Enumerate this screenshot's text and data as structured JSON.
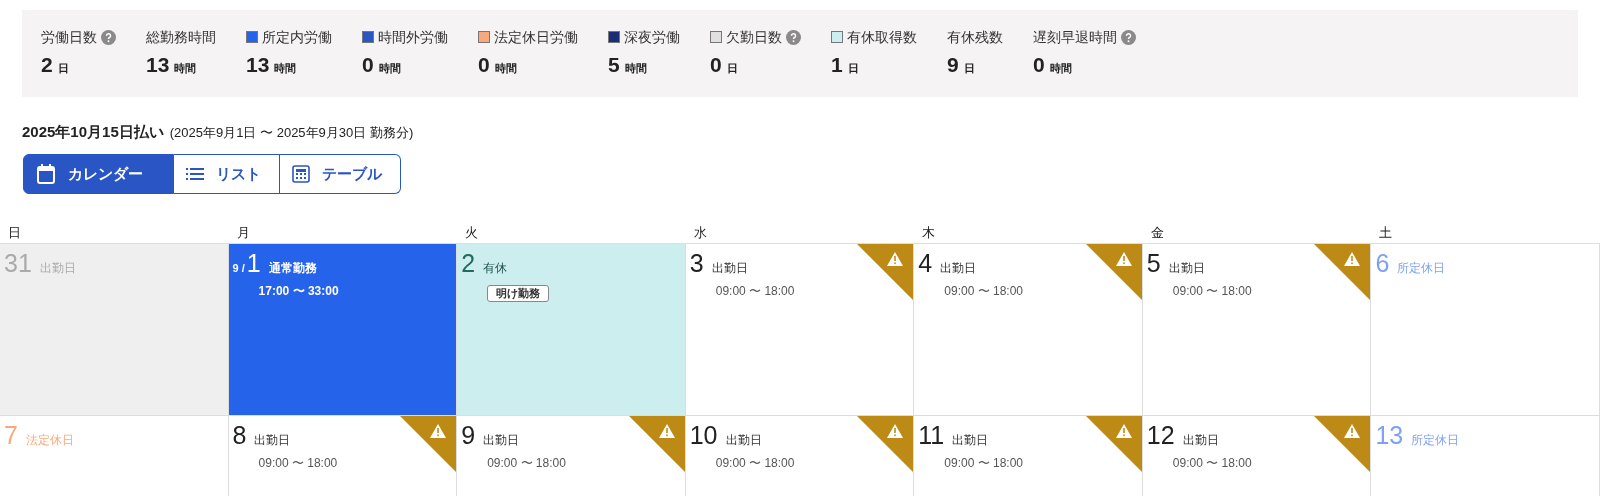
{
  "summary": [
    {
      "label": "労働日数",
      "value": "2",
      "unit": "日",
      "help": true
    },
    {
      "label": "総勤務時間",
      "value": "13",
      "unit": "時間",
      "help": false
    },
    {
      "label": "所定内労働",
      "value": "13",
      "unit": "時間",
      "help": false,
      "color": "#2563eb"
    },
    {
      "label": "時間外労働",
      "value": "0",
      "unit": "時間",
      "help": false,
      "color": "#2a55c4"
    },
    {
      "label": "法定休日労働",
      "value": "0",
      "unit": "時間",
      "help": false,
      "color": "#f8a97c"
    },
    {
      "label": "深夜労働",
      "value": "5",
      "unit": "時間",
      "help": false,
      "color": "#1a2e78"
    },
    {
      "label": "欠勤日数",
      "value": "0",
      "unit": "日",
      "help": true,
      "color": "#e0e0e0"
    },
    {
      "label": "有休取得数",
      "value": "1",
      "unit": "日",
      "help": false,
      "color": "#cdeeee"
    },
    {
      "label": "有休残数",
      "value": "9",
      "unit": "日",
      "help": false
    },
    {
      "label": "遅刻早退時間",
      "value": "0",
      "unit": "時間",
      "help": true
    }
  ],
  "period": {
    "title": "2025年10月15日払い",
    "range": "(2025年9月1日 〜 2025年9月30日 勤務分)"
  },
  "view_tabs": [
    {
      "label": "カレンダー",
      "kind": "calendar",
      "selected": true
    },
    {
      "label": "リスト",
      "kind": "list",
      "selected": false
    },
    {
      "label": "テーブル",
      "kind": "table",
      "selected": false
    }
  ],
  "weekdays": [
    "日",
    "月",
    "火",
    "水",
    "木",
    "金",
    "土"
  ],
  "weeks": [
    [
      {
        "day": "31",
        "kind": "other_month",
        "label": "出勤日",
        "warning": false
      },
      {
        "day": "1",
        "month": "9 /",
        "kind": "shift",
        "label": "通常勤務",
        "time": "17:00 〜 33:00",
        "warning": false
      },
      {
        "day": "2",
        "kind": "leave",
        "label": "有休",
        "badge": "明け勤務",
        "warning": false
      },
      {
        "day": "3",
        "kind": "workday",
        "label": "出勤日",
        "time": "09:00 〜 18:00",
        "warning": true
      },
      {
        "day": "4",
        "kind": "workday",
        "label": "出勤日",
        "time": "09:00 〜 18:00",
        "warning": true
      },
      {
        "day": "5",
        "kind": "workday",
        "label": "出勤日",
        "time": "09:00 〜 18:00",
        "warning": true
      },
      {
        "day": "6",
        "kind": "scheduled_holiday",
        "label": "所定休日",
        "warning": false
      }
    ],
    [
      {
        "day": "7",
        "kind": "legal_holiday",
        "label": "法定休日",
        "warning": false
      },
      {
        "day": "8",
        "kind": "workday",
        "label": "出勤日",
        "time": "09:00 〜 18:00",
        "warning": true
      },
      {
        "day": "9",
        "kind": "workday",
        "label": "出勤日",
        "time": "09:00 〜 18:00",
        "warning": true
      },
      {
        "day": "10",
        "kind": "workday",
        "label": "出勤日",
        "time": "09:00 〜 18:00",
        "warning": true
      },
      {
        "day": "11",
        "kind": "workday",
        "label": "出勤日",
        "time": "09:00 〜 18:00",
        "warning": true
      },
      {
        "day": "12",
        "kind": "workday",
        "label": "出勤日",
        "time": "09:00 〜 18:00",
        "warning": true
      },
      {
        "day": "13",
        "kind": "scheduled_holiday",
        "label": "所定休日",
        "warning": false
      }
    ]
  ]
}
